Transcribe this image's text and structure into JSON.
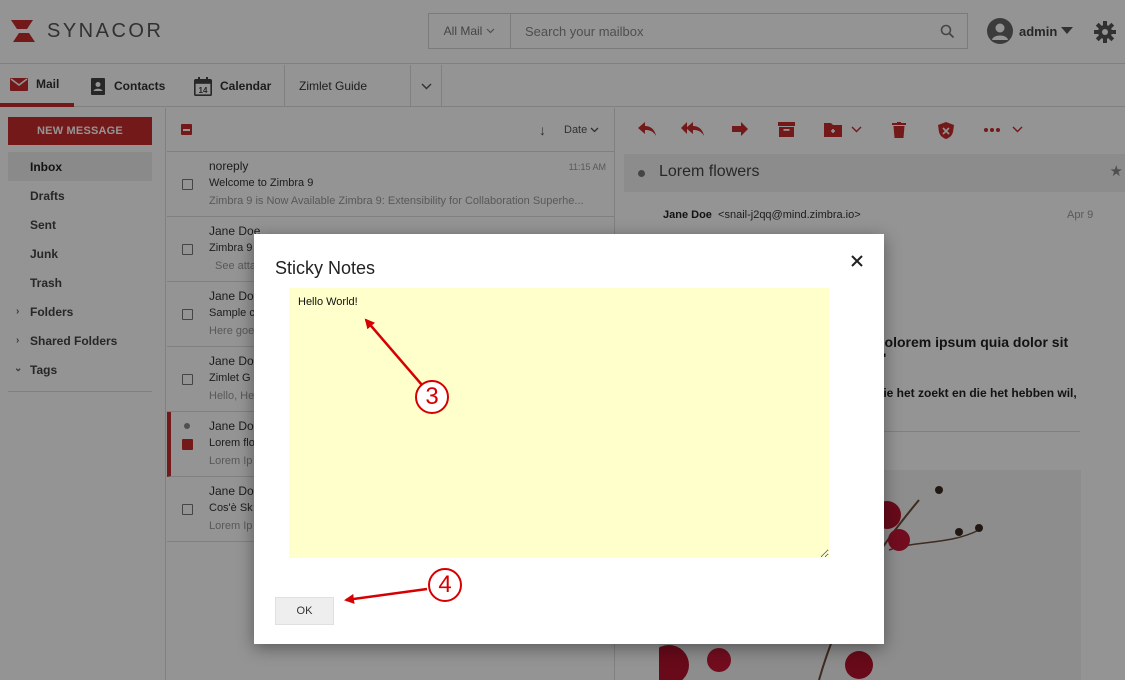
{
  "header": {
    "brand": "SYNACOR",
    "search_scope": "All Mail",
    "search_placeholder": "Search your mailbox",
    "user_name": "admin"
  },
  "nav": {
    "tabs": [
      {
        "label": "Mail",
        "icon": "mail-icon"
      },
      {
        "label": "Contacts",
        "icon": "contacts-icon"
      },
      {
        "label": "Calendar",
        "icon": "calendar-icon",
        "icon_text": "14"
      },
      {
        "label": "Zimlet Guide"
      }
    ]
  },
  "sidebar": {
    "new_message": "NEW MESSAGE",
    "folders": [
      "Inbox",
      "Drafts",
      "Sent",
      "Junk",
      "Trash"
    ],
    "groups": [
      "Folders",
      "Shared Folders",
      "Tags"
    ]
  },
  "message_list": {
    "sort_label": "Date",
    "messages": [
      {
        "from": "noreply",
        "time": "11:15 AM",
        "subject": "Welcome to Zimbra 9",
        "preview": "Zimbra 9 is Now Available Zimbra 9: Extensibility for Collaboration Superhe..."
      },
      {
        "from": "Jane Doe",
        "time": "",
        "subject": "Zimbra 9",
        "preview": "See atta"
      },
      {
        "from": "Jane Do",
        "time": "",
        "subject": "Sample c",
        "preview": "Here goe"
      },
      {
        "from": "Jane Do",
        "time": "",
        "subject": "Zimlet G",
        "preview": "Hello, He"
      },
      {
        "from": "Jane Do",
        "time": "",
        "subject": "Lorem flo",
        "preview": "Lorem Ip"
      },
      {
        "from": "Jane Do",
        "time": "",
        "subject": "Cos'è Sk",
        "preview": "Lorem Ip"
      }
    ]
  },
  "reader": {
    "subject": "Lorem flowers",
    "sender_name": "Jane Doe",
    "sender_email": "<snail-j2qq@mind.zimbra.io>",
    "date": "Apr 9",
    "body_line1": "dolorem ipsum quia dolor sit",
    "body_line2": ".\"",
    "body_line3": "die het zoekt en die het hebben wil,"
  },
  "dialog": {
    "title": "Sticky Notes",
    "note_text": "Hello World!",
    "ok_label": "OK"
  },
  "annotations": {
    "step_a": "3",
    "step_b": "4",
    "color": "#d60000"
  },
  "colors": {
    "brand_red": "#c92b2b",
    "note_yellow": "#ffffcc"
  }
}
